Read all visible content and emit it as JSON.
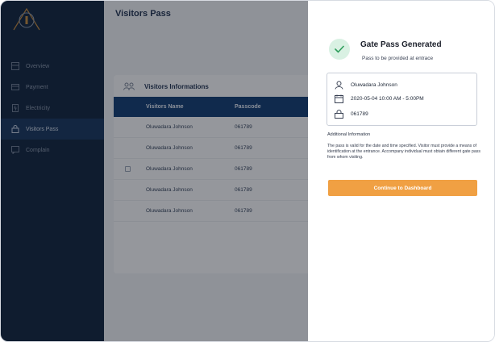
{
  "sidebar": {
    "items": [
      {
        "label": "Overview",
        "icon": "grid-icon"
      },
      {
        "label": "Payment",
        "icon": "card-icon"
      },
      {
        "label": "Electricity",
        "icon": "plug-icon"
      },
      {
        "label": "Visitors Pass",
        "icon": "lock-icon",
        "active": true
      },
      {
        "label": "Complain",
        "icon": "chat-icon"
      }
    ]
  },
  "main": {
    "title": "Visitors Pass",
    "card_title": "Visitors Informations",
    "columns": [
      "Visitors Name",
      "Passcode"
    ],
    "rows": [
      {
        "name": "Oluwadara Johnson",
        "passcode": "061789"
      },
      {
        "name": "Oluwadara Johnson",
        "passcode": "061789"
      },
      {
        "name": "Oluwadara Johnson",
        "passcode": "061789"
      },
      {
        "name": "Oluwadara Johnson",
        "passcode": "061789"
      },
      {
        "name": "Oluwadara Johnson",
        "passcode": "061789"
      }
    ]
  },
  "panel": {
    "title": "Gate Pass Generated",
    "subtitle": "Pass to be provided at entrace",
    "visitor_name": "Oluwadara Johnson",
    "datetime": "2020-05-04 10:00 AM - 5:00PM",
    "passcode": "061789",
    "additional_label": "Additional Information",
    "additional_text": "The pass is valid for the date and time specified. Visitor must provide a means of identification at the entrance. Accompany individual must obtain different gate pass from whom visiting.",
    "button_label": "Continue to Dashboard"
  },
  "colors": {
    "sidebar_bg": "#0b1f3a",
    "table_header": "#0e3a70",
    "accent_button": "#f0a043",
    "success": "#2f9e5c"
  }
}
